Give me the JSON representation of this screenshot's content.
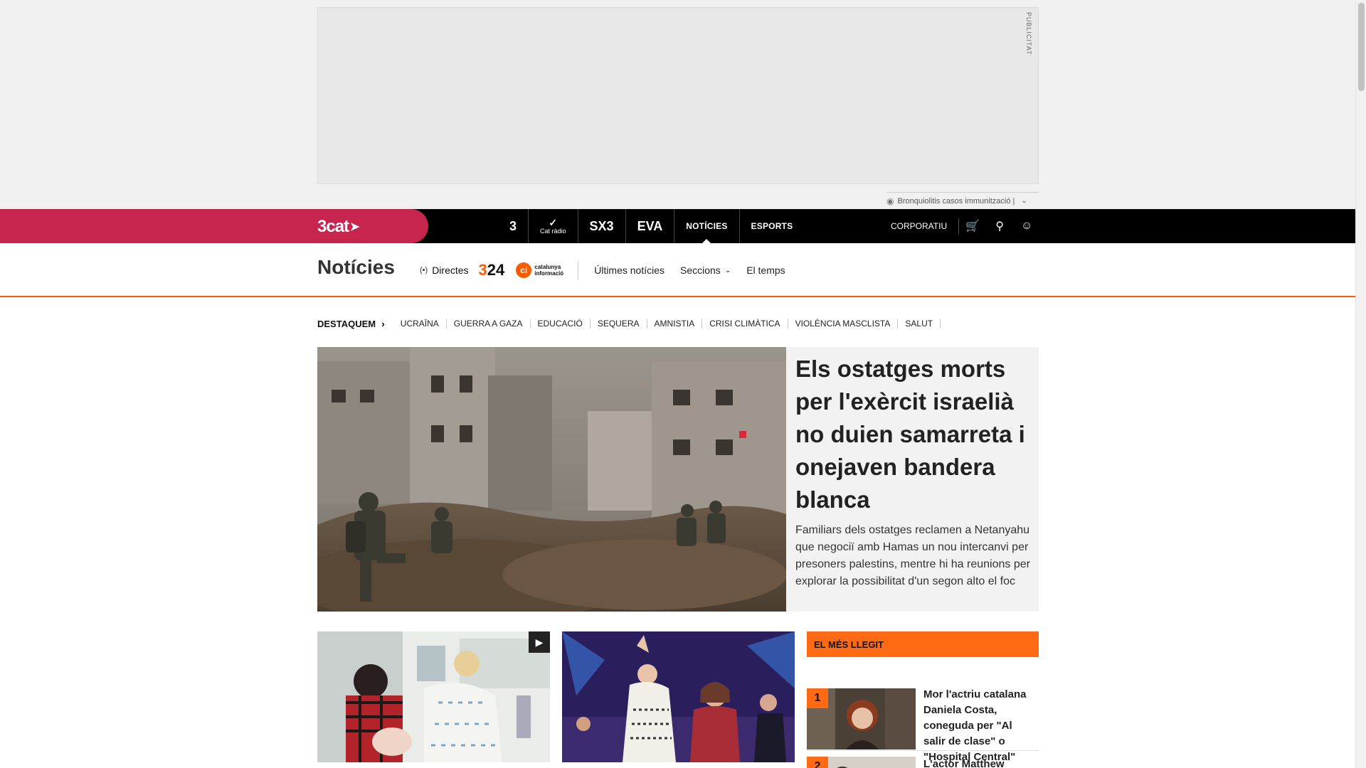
{
  "ad": {
    "label": "PUBLICITAT",
    "trending_text": "Bronquiolitis casos immunització |"
  },
  "topbar": {
    "brand": "3cat",
    "channels": [
      "3",
      "Cat Ràdio",
      "SX3",
      "EVA",
      "NOTÍCIES",
      "ESPORTS"
    ],
    "catradio_caption": "Cat ràdio",
    "corporate": "CORPORATIU"
  },
  "section": {
    "title": "Notícies",
    "live": "Directes",
    "logo_324": "324",
    "logo_ci_line1": "catalunya",
    "logo_ci_line2": "informació",
    "links": [
      "Últimes notícies",
      "Seccions",
      "El temps"
    ]
  },
  "tags": {
    "lead": "DESTAQUEM",
    "items": [
      "UCRAÏNA",
      "GUERRA A GAZA",
      "EDUCACIÓ",
      "SEQUERA",
      "AMNISTIA",
      "CRISI CLIMÀTICA",
      "VIOLÈNCIA MASCLISTA",
      "SALUT"
    ]
  },
  "hero": {
    "title": "Els ostatges morts per l'exèrcit israelià no duien samarreta i onejaven bandera blanca",
    "subtitle": "Familiars dels ostatges reclamen a Netanyahu que negociï amb Hamas un nou intercanvi per presoners palestins, mentre hi ha reunions per explorar la possibilitat d'un segon alto el foc"
  },
  "most_read": {
    "heading": "EL MÉS LLEGIT",
    "items": [
      {
        "rank": "1",
        "title": "Mor l'actriu catalana Daniela Costa, coneguda per \"Al salir de clase\" o \"Hospital Central\""
      },
      {
        "rank": "2",
        "title": "L'actor Matthew Perry"
      }
    ]
  },
  "colors": {
    "brand": "#c7254e",
    "accent": "#ff6a13",
    "topbar": "#000000"
  }
}
